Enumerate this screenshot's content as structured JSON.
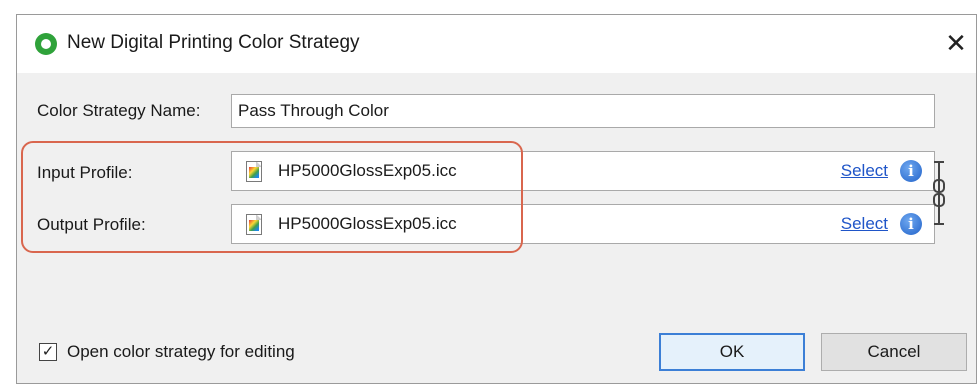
{
  "window": {
    "title": "New Digital Printing Color Strategy",
    "close_glyph": "✕",
    "app_icon": "circle-logo-icon",
    "accent_color": "#2fa23a"
  },
  "form": {
    "name_label": "Color Strategy Name:",
    "name_value": "Pass Through Color",
    "input_profile": {
      "label": "Input Profile:",
      "file": "HP5000GlossExp05.icc",
      "select_label": "Select",
      "info_glyph": "i"
    },
    "output_profile": {
      "label": "Output Profile:",
      "file": "HP5000GlossExp05.icc",
      "select_label": "Select",
      "info_glyph": "i"
    },
    "highlight_color": "#d9664e"
  },
  "footer": {
    "checkbox_label": "Open color strategy for editing",
    "checkbox_checked": true,
    "checkbox_glyph": "✓",
    "ok_label": "OK",
    "cancel_label": "Cancel"
  }
}
